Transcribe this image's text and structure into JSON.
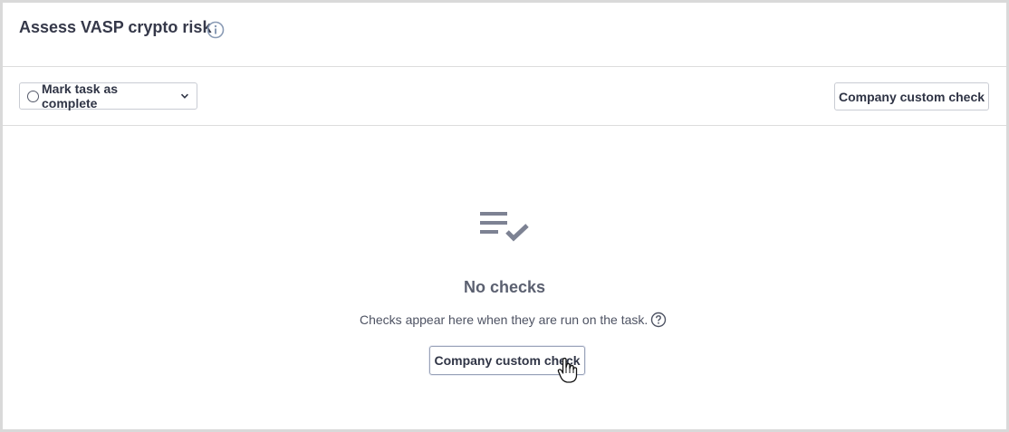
{
  "header": {
    "title": "Assess VASP crypto risk",
    "info_icon": "info-icon"
  },
  "toolbar": {
    "mark_complete_label": "Mark task as complete",
    "custom_check_label": "Company custom check"
  },
  "empty_state": {
    "icon": "checklist-icon",
    "title": "No checks",
    "description": "Checks appear here when they are run on the task.",
    "help_icon": "question-icon",
    "button_label": "Company custom check"
  },
  "colors": {
    "border": "#d9d9d9",
    "text": "#2f3445",
    "muted": "#5b6070",
    "icon": "#7d8293"
  }
}
